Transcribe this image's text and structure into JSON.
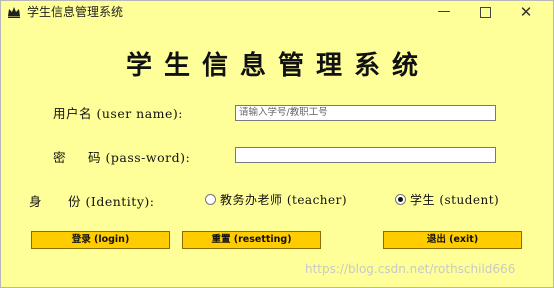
{
  "window": {
    "title": "学生信息管理系统",
    "controls": {
      "minimize": "—",
      "close": "✕"
    },
    "background_color": "#ffff99"
  },
  "heading": "学生信息管理系统",
  "form": {
    "username_label": "用户名 (user name):",
    "username_placeholder": "请输入学号/教职工号",
    "username_value": "",
    "password_label_zh_1": "密",
    "password_label_zh_2": "码",
    "password_label_en": "(pass-word):",
    "password_value": "",
    "identity_label_zh_1": "身",
    "identity_label_zh_2": "份",
    "identity_label_en": "(Identity):",
    "identity_options": [
      {
        "label": "教务办老师 (teacher)",
        "selected": false
      },
      {
        "label": "学生 (student)",
        "selected": true
      }
    ]
  },
  "buttons": {
    "login": "登录 (login)",
    "reset": "重置 (resetting)",
    "exit": "退出 (exit)",
    "color": "#ffcc00"
  },
  "watermark": "https://blog.csdn.net/rothschild666",
  "icons": {
    "app": "crown-icon"
  }
}
